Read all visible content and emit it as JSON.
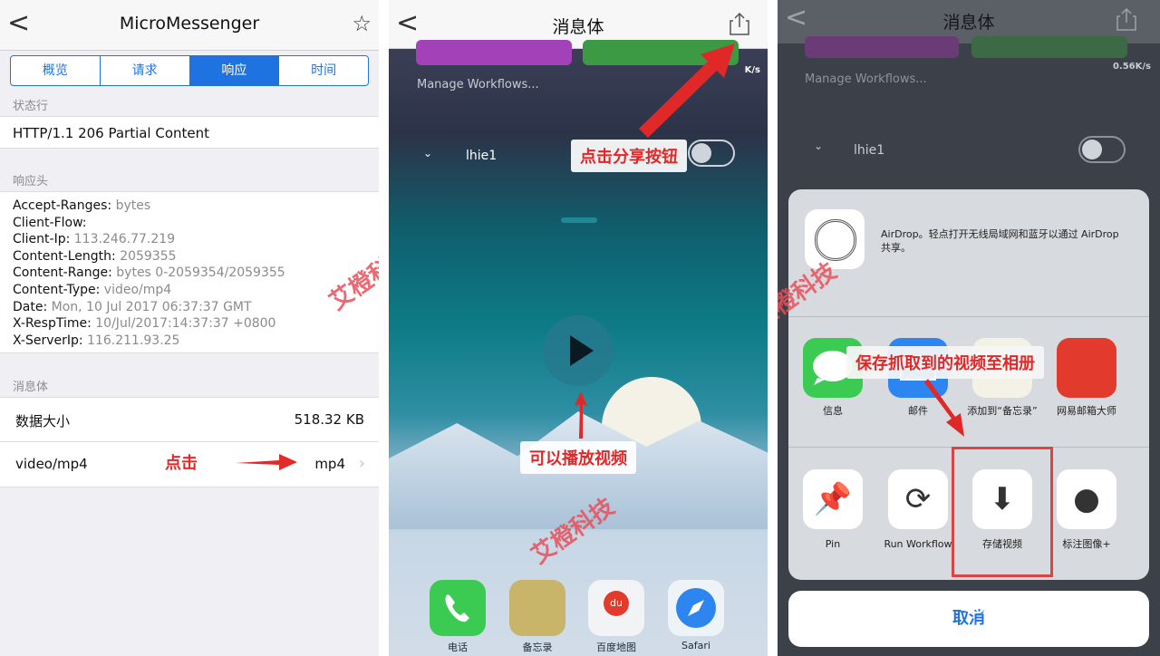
{
  "panel1": {
    "nav": {
      "back": "<",
      "title": "MicroMessenger",
      "star": "☆"
    },
    "tabs": [
      "概览",
      "请求",
      "响应",
      "时间"
    ],
    "active_tab": "响应",
    "status_section": {
      "title": "状态行",
      "line": "HTTP/1.1 206 Partial Content"
    },
    "headers_section": {
      "title": "响应头",
      "headers": [
        {
          "key": "Accept-Ranges:",
          "value": " bytes"
        },
        {
          "key": "Client-Flow:",
          "value": ""
        },
        {
          "key": "Client-Ip:",
          "value": " 113.246.77.219"
        },
        {
          "key": "Content-Length:",
          "value": " 2059355"
        },
        {
          "key": "Content-Range:",
          "value": " bytes 0-2059354/2059355"
        },
        {
          "key": "Content-Type:",
          "value": " video/mp4"
        },
        {
          "key": "Date:",
          "value": " Mon, 10 Jul 2017 06:37:37 GMT"
        },
        {
          "key": "X-RespTime:",
          "value": " 10/Jul/2017:14:37:37 +0800"
        },
        {
          "key": "X-ServerIp:",
          "value": " 116.211.93.25"
        }
      ]
    },
    "body_section": {
      "title": "消息体",
      "size_label": "数据大小",
      "size_value": "518.32 KB",
      "type_label": "video/mp4",
      "type_value": "mp4",
      "chevron": "›"
    },
    "annotation": "点击"
  },
  "panel2": {
    "nav": {
      "back": "<",
      "title": "消息体"
    },
    "manage": "Manage Workflows...",
    "speed": "K/s",
    "workflow": "lhie1",
    "callout_share": "点击分享按钮",
    "callout_play": "可以播放视频",
    "dock": [
      {
        "label": "电话",
        "color": "#3ccb52"
      },
      {
        "label": "备忘录",
        "color": "#c9b56a"
      },
      {
        "label": "百度地图",
        "color": "#f1f3f5"
      },
      {
        "label": "Safari",
        "color": "#eef3f8"
      }
    ],
    "map_glyph": "du"
  },
  "panel3": {
    "nav": {
      "back": "<",
      "title": "消息体"
    },
    "manage": "Manage Workflows...",
    "speed": "0.56K/s",
    "workflow": "lhie1",
    "airdrop": "AirDrop。轻点打开无线局域网和蓝牙以通过 AirDrop 共享。",
    "airdrop_title": "AirDrop",
    "callout_save": "保存抓取到的视频至相册",
    "apps": [
      {
        "label": "信息",
        "color": "#3ccb52"
      },
      {
        "label": "邮件",
        "color": "#2d86f0"
      },
      {
        "label": "添加到“备忘录”",
        "color": "#f4f1e6"
      },
      {
        "label": "网易邮箱大师",
        "color": "#e23b2e"
      }
    ],
    "actions": [
      {
        "label": "Pin",
        "glyph": "📌"
      },
      {
        "label": "Run Workflow",
        "glyph": "⟳"
      },
      {
        "label": "存储视频",
        "glyph": "⬇"
      },
      {
        "label": "标注图像+",
        "glyph": "●"
      }
    ],
    "cancel": "取消",
    "brand": "艾橙科技"
  },
  "watermark": "艾橙科技"
}
